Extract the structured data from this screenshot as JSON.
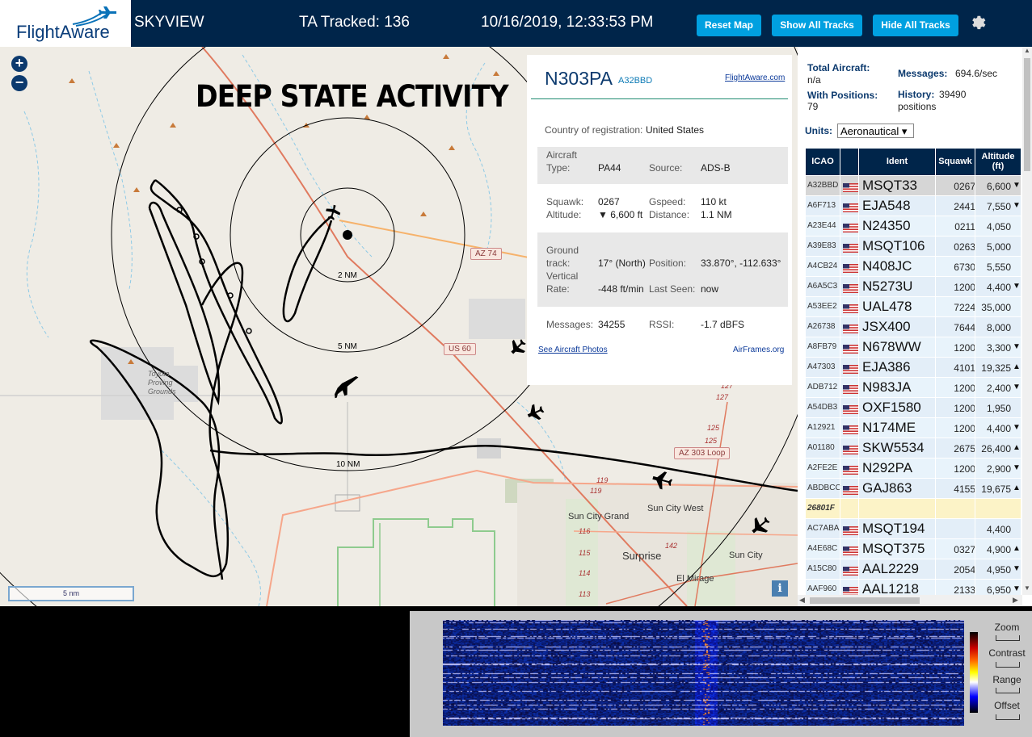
{
  "header": {
    "brand": "FlightAware",
    "app_name": "SKYVIEW",
    "tracked": "TA Tracked: 136",
    "datetime": "10/16/2019, 12:33:53 PM",
    "buttons": {
      "reset": "Reset Map",
      "show_all": "Show All Tracks",
      "hide_all": "Hide All Tracks"
    },
    "settings_icon": "gear-icon"
  },
  "map": {
    "overlay_title": "DEEP STATE ACTIVITY",
    "zoom_in": "+",
    "zoom_out": "−",
    "rings": [
      "2 NM",
      "5 NM",
      "10 NM"
    ],
    "roads": [
      "AZ 74",
      "US 60",
      "AZ 303 Loop"
    ],
    "places": [
      "Sun City Grand",
      "Sun City West",
      "Surprise",
      "Sun City",
      "El Mirage",
      "Toyota Proving Grounds"
    ],
    "road_numbers": [
      "127",
      "127",
      "125",
      "125",
      "119",
      "119",
      "116",
      "115",
      "114",
      "113",
      "142"
    ],
    "scale": "5 nm",
    "info_button": "i"
  },
  "selected": {
    "registration": "N303PA",
    "icao": "A32BBD",
    "fa_link": "FlightAware.com",
    "country_label": "Country of registration:",
    "country": "United States",
    "aircraft_type_label": "Aircraft Type:",
    "aircraft_type_label_1": "Aircraft",
    "aircraft_type_label_2": "Type:",
    "aircraft_type": "PA44",
    "source_label": "Source:",
    "source": "ADS-B",
    "squawk_label": "Squawk:",
    "squawk": "0267",
    "gspeed_label": "Gspeed:",
    "gspeed": "110 kt",
    "altitude_label": "Altitude:",
    "altitude": "▼ 6,600 ft",
    "distance_label": "Distance:",
    "distance": "1.1 NM",
    "ground_track_label_1": "Ground",
    "ground_track_label_2": "track:",
    "ground_track": "17° (North)",
    "position_label": "Position:",
    "position": "33.870°, -112.633°",
    "vrate_label_1": "Vertical",
    "vrate_label_2": "Rate:",
    "vrate": "-448 ft/min",
    "last_seen_label": "Last Seen:",
    "last_seen": "now",
    "messages_label": "Messages:",
    "messages": "34255",
    "rssi_label": "RSSI:",
    "rssi": "-1.7 dBFS",
    "photos_link": "See Aircraft Photos",
    "airframes_link": "AirFrames.org"
  },
  "stats": {
    "total_aircraft_label": "Total Aircraft:",
    "total_aircraft": "n/a",
    "messages_label": "Messages:",
    "messages": "694.6/sec",
    "with_positions_label": "With Positions:",
    "with_positions": "79",
    "history_label": "History:",
    "history": "39490",
    "history_unit": "positions",
    "units_label": "Units:",
    "units_value": "Aeronautical ▾"
  },
  "table": {
    "headers": [
      "ICAO",
      "",
      "Ident",
      "Squawk",
      "Altitude (ft)"
    ],
    "altitude_header_1": "Altitude",
    "altitude_header_2": "(ft)",
    "rows": [
      {
        "icao": "A32BBD",
        "ident": "MSQT33",
        "squawk": "0267",
        "altitude": "6,600",
        "trend": "▼",
        "flag": true,
        "sel": true
      },
      {
        "icao": "A6F713",
        "ident": "EJA548",
        "squawk": "2441",
        "altitude": "7,550",
        "trend": "▼",
        "flag": true
      },
      {
        "icao": "A23E44",
        "ident": "N24350",
        "squawk": "0211",
        "altitude": "4,050",
        "trend": "",
        "flag": true
      },
      {
        "icao": "A39E83",
        "ident": "MSQT106",
        "squawk": "0263",
        "altitude": "5,000",
        "trend": "",
        "flag": true
      },
      {
        "icao": "A4CB24",
        "ident": "N408JC",
        "squawk": "6730",
        "altitude": "5,550",
        "trend": "",
        "flag": true
      },
      {
        "icao": "A6A5C3",
        "ident": "N5273U",
        "squawk": "1200",
        "altitude": "4,400",
        "trend": "▼",
        "flag": true
      },
      {
        "icao": "A53EE2",
        "ident": "UAL478",
        "squawk": "7224",
        "altitude": "35,000",
        "trend": "",
        "flag": true
      },
      {
        "icao": "A26738",
        "ident": "JSX400",
        "squawk": "7644",
        "altitude": "8,000",
        "trend": "",
        "flag": true
      },
      {
        "icao": "A8FB79",
        "ident": "N678WW",
        "squawk": "1200",
        "altitude": "3,300",
        "trend": "▼",
        "flag": true
      },
      {
        "icao": "A47303",
        "ident": "EJA386",
        "squawk": "4101",
        "altitude": "19,325",
        "trend": "▲",
        "flag": true
      },
      {
        "icao": "ADB712",
        "ident": "N983JA",
        "squawk": "1200",
        "altitude": "2,400",
        "trend": "▼",
        "flag": true
      },
      {
        "icao": "A54DB3",
        "ident": "OXF1580",
        "squawk": "1200",
        "altitude": "1,950",
        "trend": "",
        "flag": true
      },
      {
        "icao": "A12921",
        "ident": "N174ME",
        "squawk": "1200",
        "altitude": "4,400",
        "trend": "▼",
        "flag": true
      },
      {
        "icao": "A01180",
        "ident": "SKW5534",
        "squawk": "2675",
        "altitude": "26,400",
        "trend": "▲",
        "flag": true
      },
      {
        "icao": "A2FE2E",
        "ident": "N292PA",
        "squawk": "1200",
        "altitude": "2,900",
        "trend": "▼",
        "flag": true
      },
      {
        "icao": "ABDBCC",
        "ident": "GAJ863",
        "squawk": "4155",
        "altitude": "19,675",
        "trend": "▲",
        "flag": true
      },
      {
        "icao": "26801F",
        "ident": "",
        "squawk": "",
        "altitude": "",
        "trend": "",
        "flag": false,
        "nopos": true
      },
      {
        "icao": "AC7ABA",
        "ident": "MSQT194",
        "squawk": "",
        "altitude": "4,400",
        "trend": "",
        "flag": true
      },
      {
        "icao": "A4E68C",
        "ident": "MSQT375",
        "squawk": "0327",
        "altitude": "4,900",
        "trend": "▲",
        "flag": true
      },
      {
        "icao": "A15C80",
        "ident": "AAL2229",
        "squawk": "2054",
        "altitude": "4,950",
        "trend": "▼",
        "flag": true
      },
      {
        "icao": "AAF960",
        "ident": "AAL1218",
        "squawk": "2133",
        "altitude": "6,950",
        "trend": "▼",
        "flag": true
      }
    ]
  },
  "waterfall": {
    "labels": [
      "Zoom",
      "Contrast",
      "Range",
      "Offset"
    ]
  },
  "colors": {
    "header_bg": "#00254a",
    "button_bg": "#00a0e0",
    "table_header_bg": "#00254a"
  }
}
